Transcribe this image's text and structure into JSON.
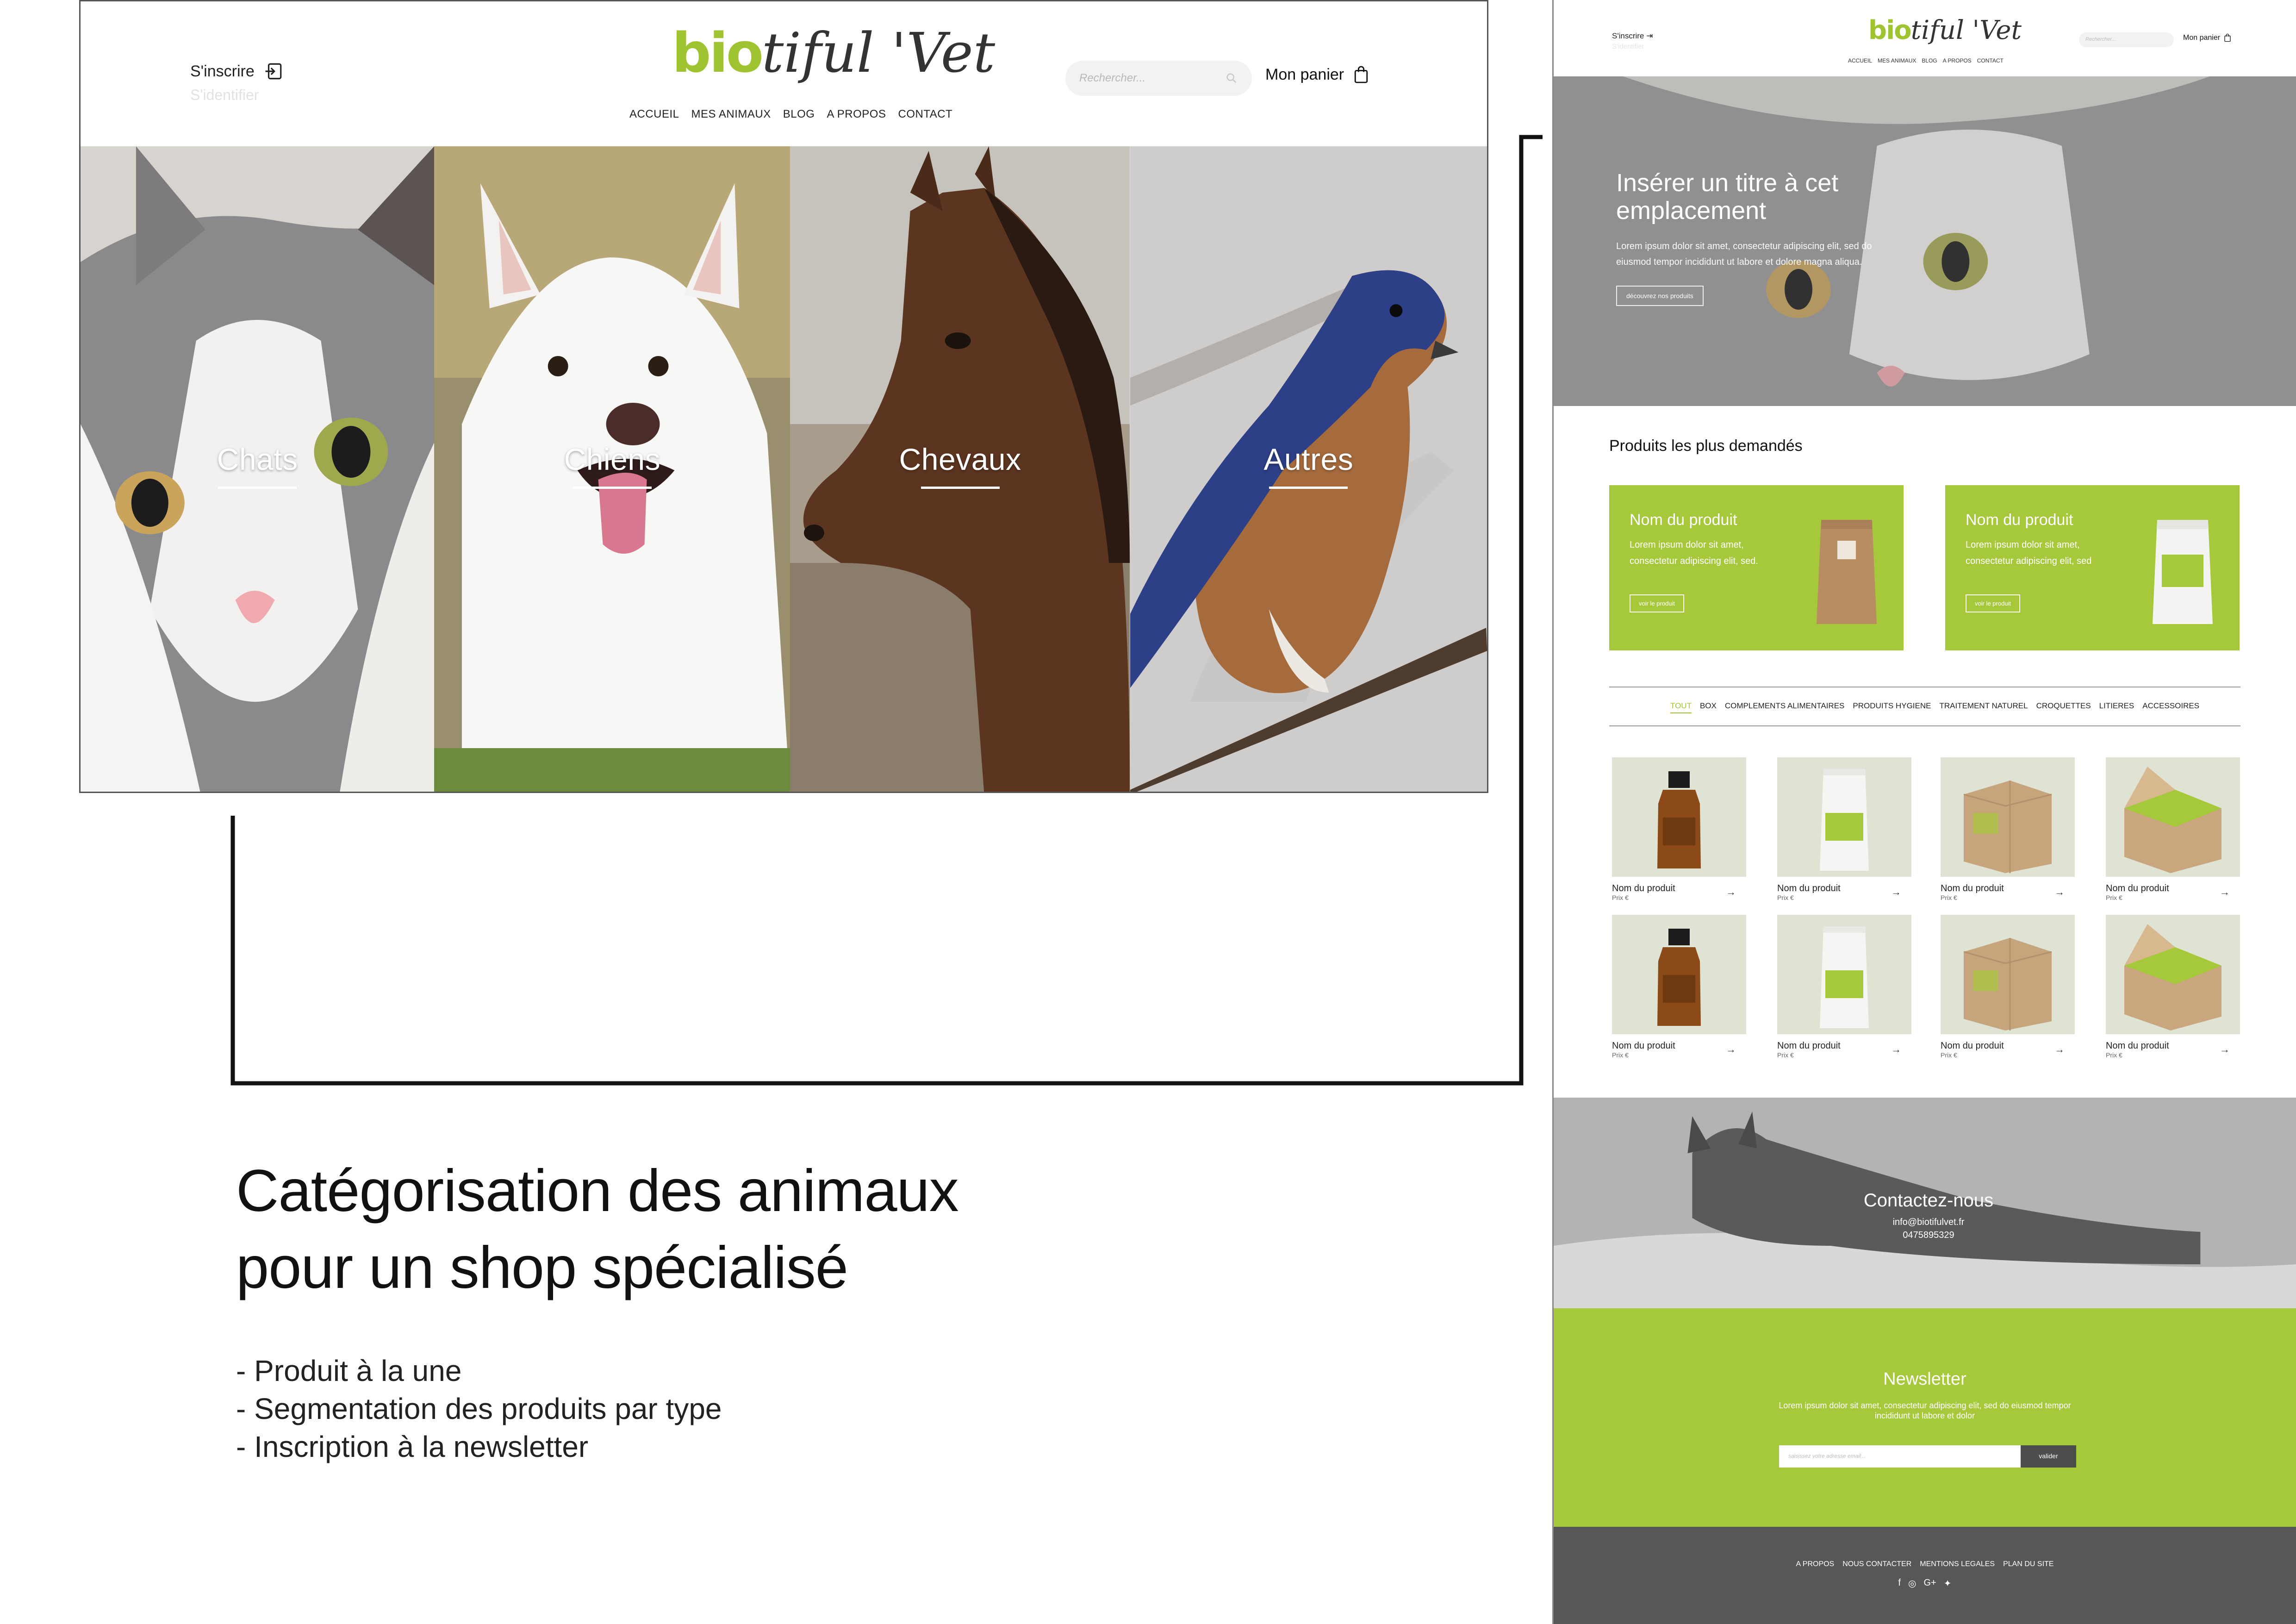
{
  "main_mockup": {
    "auth": {
      "signup": "S'inscrire",
      "login": "S'identifier"
    },
    "logo": {
      "green": "bio",
      "dark": "tiful 'Vet"
    },
    "nav": [
      "ACCUEIL",
      "MES ANIMAUX",
      "BLOG",
      "A PROPOS",
      "CONTACT"
    ],
    "search_placeholder": "Rechercher...",
    "cart_label": "Mon panier",
    "categories": [
      "Chats",
      "Chiens",
      "Chevaux",
      "Autres"
    ]
  },
  "caption": {
    "title_line1": "Catégorisation des animaux",
    "title_line2": "pour un shop spécialisé",
    "bullets": [
      "- Produit à la une",
      "- Segmentation des produits par type",
      "- Inscription à la newsletter"
    ]
  },
  "page_mockup": {
    "auth": {
      "signup": "S'inscrire",
      "login": "S'identifier"
    },
    "logo": {
      "green": "bio",
      "dark": "tiful 'Vet"
    },
    "nav": [
      "ACCUEIL",
      "MES ANIMAUX",
      "BLOG",
      "A PROPOS",
      "CONTACT"
    ],
    "search_placeholder": "Rechercher...",
    "cart_label": "Mon panier",
    "hero": {
      "title": "Insérer un titre à cet emplacement",
      "text": "Lorem ipsum dolor sit amet, consectetur adipiscing elit, sed do eiusmod tempor incididunt ut labore et dolore magna aliqua.",
      "button": "découvrez nos produits"
    },
    "featured_title": "Produits les plus demandés",
    "featured": [
      {
        "name": "Nom du produit",
        "desc": "Lorem ipsum dolor sit amet, consectetur adipiscing elit, sed.",
        "button": "voir le produit"
      },
      {
        "name": "Nom du produit",
        "desc": "Lorem ipsum dolor sit amet, consectetur adipiscing elit, sed",
        "button": "voir le produit"
      }
    ],
    "tabs": [
      "TOUT",
      "BOX",
      "COMPLEMENTS ALIMENTAIRES",
      "PRODUITS HYGIENE",
      "TRAITEMENT NATUREL",
      "CROQUETTES",
      "LITIERES",
      "ACCESSOIRES"
    ],
    "products": [
      {
        "name": "Nom du produit",
        "price": "Prix €",
        "kind": "bottle"
      },
      {
        "name": "Nom du produit",
        "price": "Prix €",
        "kind": "pouch"
      },
      {
        "name": "Nom du produit",
        "price": "Prix €",
        "kind": "box"
      },
      {
        "name": "Nom du produit",
        "price": "Prix €",
        "kind": "open-box"
      },
      {
        "name": "Nom du produit",
        "price": "Prix €",
        "kind": "bottle"
      },
      {
        "name": "Nom du produit",
        "price": "Prix €",
        "kind": "pouch"
      },
      {
        "name": "Nom du produit",
        "price": "Prix €",
        "kind": "box"
      },
      {
        "name": "Nom du produit",
        "price": "Prix €",
        "kind": "open-box"
      }
    ],
    "contact": {
      "title": "Contactez-nous",
      "email": "info@biotifulvet.fr",
      "phone": "0475895329"
    },
    "newsletter": {
      "title": "Newsletter",
      "text": "Lorem ipsum dolor sit amet, consectetur adipiscing elit, sed do eiusmod tempor incididunt ut labore et dolor",
      "placeholder": "saisissez votre adresse email...",
      "button": "valider"
    },
    "footer_links": [
      "A PROPOS",
      "NOUS CONTACTER",
      "MENTIONS LEGALES",
      "PLAN DU SITE"
    ],
    "social_icons": [
      "facebook-icon",
      "instagram-icon",
      "google-plus-icon",
      "twitter-icon"
    ]
  },
  "colors": {
    "brand_green": "#a5c93b",
    "footer_grey": "#575757"
  }
}
